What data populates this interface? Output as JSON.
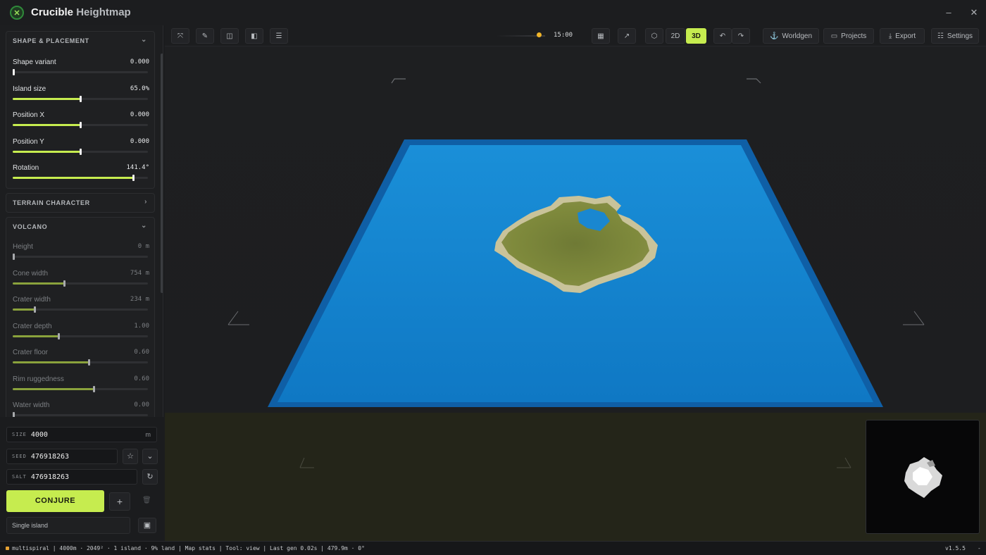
{
  "app": {
    "title_main": "Crucible",
    "title_sub": "Heightmap",
    "minimize_icon": "minimize-icon",
    "close_icon": "close-icon"
  },
  "sections": {
    "shape": {
      "title": "SHAPE & PLACEMENT",
      "expanded": true,
      "sliders": [
        {
          "label": "Shape variant",
          "value": "0.000",
          "fraction": 0.0
        },
        {
          "label": "Island size",
          "value": "65.0%",
          "fraction": 0.5
        },
        {
          "label": "Position X",
          "value": "0.000",
          "fraction": 0.5
        },
        {
          "label": "Position Y",
          "value": "0.000",
          "fraction": 0.5
        },
        {
          "label": "Rotation",
          "value": "141.4°",
          "fraction": 0.89
        }
      ]
    },
    "terrain": {
      "title": "TERRAIN CHARACTER",
      "expanded": false
    },
    "volcano": {
      "title": "VOLCANO",
      "expanded": true,
      "sliders": [
        {
          "label": "Height",
          "value": "0 m",
          "fraction": 0.0
        },
        {
          "label": "Cone width",
          "value": "754 m",
          "fraction": 0.38
        },
        {
          "label": "Crater width",
          "value": "234 m",
          "fraction": 0.16
        },
        {
          "label": "Crater depth",
          "value": "1.00",
          "fraction": 0.34
        },
        {
          "label": "Crater floor",
          "value": "0.60",
          "fraction": 0.56
        },
        {
          "label": "Rim ruggedness",
          "value": "0.60",
          "fraction": 0.6
        },
        {
          "label": "Water width",
          "value": "0.00",
          "fraction": 0.0
        }
      ]
    }
  },
  "controls": {
    "size_label": "SIZE",
    "size_value": "4000",
    "size_unit": "m",
    "seed_label": "SEED",
    "seed_value": "476918263",
    "salt_label": "SALT",
    "salt_value": "476918263",
    "conjure_label": "CONJURE",
    "preset_value": "Single island"
  },
  "toolbar": {
    "time": "15:00",
    "mode_2d": "2D",
    "mode_3d": "3D",
    "active_mode": "3D",
    "worldgen": "Worldgen",
    "projects": "Projects",
    "export": "Export",
    "settings": "Settings"
  },
  "status": {
    "text": "multispiral | 4000m · 2049² · 1 island · 9% land | Map stats | Tool: view | Last gen 0.02s | 479.9m · 0°",
    "version": "v1.5.5",
    "extra": "-"
  },
  "colors": {
    "accent": "#c6ec4f",
    "water": "#1a8bd6",
    "water_edge": "#0f5fa6",
    "land": "#7d8a3a",
    "sand": "#c9c39a"
  }
}
